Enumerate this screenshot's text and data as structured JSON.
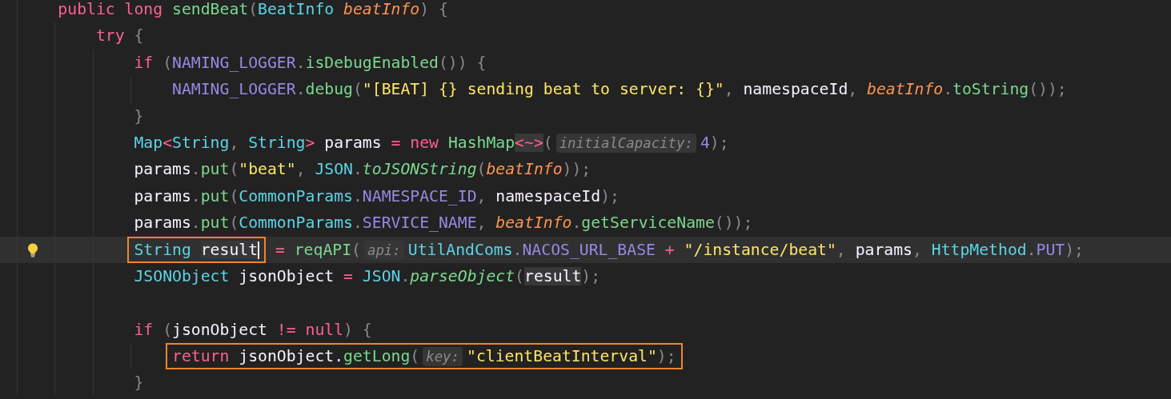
{
  "lines": [
    {
      "current": false,
      "tokens": [
        {
          "kind": "keyword",
          "text": "public "
        },
        {
          "kind": "keyword",
          "text": "long "
        },
        {
          "kind": "function",
          "text": "sendBeat"
        },
        {
          "kind": "punct",
          "text": "("
        },
        {
          "kind": "type",
          "text": "BeatInfo "
        },
        {
          "kind": "param",
          "text": "beatInfo"
        },
        {
          "kind": "punct",
          "text": ") {"
        }
      ],
      "children": [
        {
          "current": false,
          "tokens": [
            {
              "kind": "keyword",
              "text": "try "
            },
            {
              "kind": "punct",
              "text": "{"
            }
          ],
          "children": [
            {
              "current": false,
              "tokens": [
                {
                  "kind": "keyword",
                  "text": "if "
                },
                {
                  "kind": "punct",
                  "text": "("
                },
                {
                  "kind": "constant",
                  "text": "NAMING_LOGGER"
                },
                {
                  "kind": "punct",
                  "text": "."
                },
                {
                  "kind": "function",
                  "text": "isDebugEnabled"
                },
                {
                  "kind": "punct",
                  "text": "()) {"
                }
              ],
              "children": [
                {
                  "current": false,
                  "tokens": [
                    {
                      "kind": "constant",
                      "text": "NAMING_LOGGER"
                    },
                    {
                      "kind": "punct",
                      "text": "."
                    },
                    {
                      "kind": "function",
                      "text": "debug"
                    },
                    {
                      "kind": "punct",
                      "text": "("
                    },
                    {
                      "kind": "string",
                      "text": "\"[BEAT] {} sending beat to server: {}\""
                    },
                    {
                      "kind": "punct",
                      "text": ", "
                    },
                    {
                      "kind": "plain",
                      "text": "namespaceId"
                    },
                    {
                      "kind": "punct",
                      "text": ", "
                    },
                    {
                      "kind": "param",
                      "text": "beatInfo"
                    },
                    {
                      "kind": "punct",
                      "text": "."
                    },
                    {
                      "kind": "function",
                      "text": "toString"
                    },
                    {
                      "kind": "punct",
                      "text": "());"
                    }
                  ]
                }
              ]
            },
            {
              "current": false,
              "tokens": [
                {
                  "kind": "punct",
                  "text": "}"
                }
              ]
            },
            {
              "current": false,
              "tokens": [
                {
                  "kind": "type",
                  "text": "Map"
                },
                {
                  "kind": "operator",
                  "text": "<"
                },
                {
                  "kind": "type",
                  "text": "String"
                },
                {
                  "kind": "punct",
                  "text": ", "
                },
                {
                  "kind": "type",
                  "text": "String"
                },
                {
                  "kind": "operator",
                  "text": "> "
                },
                {
                  "kind": "plain",
                  "text": "params "
                },
                {
                  "kind": "operator",
                  "text": "= "
                },
                {
                  "kind": "keyword",
                  "text": "new "
                },
                {
                  "kind": "function",
                  "text": "HashMap"
                },
                {
                  "kind": "operator",
                  "text": "<~>",
                  "shaded": true
                },
                {
                  "kind": "punct",
                  "text": "("
                },
                {
                  "kind": "hint",
                  "text": "initialCapacity:"
                },
                {
                  "kind": "number",
                  "text": "4"
                },
                {
                  "kind": "punct",
                  "text": ");"
                }
              ]
            },
            {
              "current": false,
              "tokens": [
                {
                  "kind": "plain",
                  "text": "params"
                },
                {
                  "kind": "punct",
                  "text": "."
                },
                {
                  "kind": "function",
                  "text": "put"
                },
                {
                  "kind": "punct",
                  "text": "("
                },
                {
                  "kind": "string",
                  "text": "\"beat\""
                },
                {
                  "kind": "punct",
                  "text": ", "
                },
                {
                  "kind": "type",
                  "text": "JSON"
                },
                {
                  "kind": "punct",
                  "text": "."
                },
                {
                  "kind": "static",
                  "text": "toJSONString"
                },
                {
                  "kind": "punct",
                  "text": "("
                },
                {
                  "kind": "param",
                  "text": "beatInfo"
                },
                {
                  "kind": "punct",
                  "text": "));"
                }
              ]
            },
            {
              "current": false,
              "tokens": [
                {
                  "kind": "plain",
                  "text": "params"
                },
                {
                  "kind": "punct",
                  "text": "."
                },
                {
                  "kind": "function",
                  "text": "put"
                },
                {
                  "kind": "punct",
                  "text": "("
                },
                {
                  "kind": "type",
                  "text": "CommonParams"
                },
                {
                  "kind": "punct",
                  "text": "."
                },
                {
                  "kind": "constant",
                  "text": "NAMESPACE_ID"
                },
                {
                  "kind": "punct",
                  "text": ", "
                },
                {
                  "kind": "plain",
                  "text": "namespaceId"
                },
                {
                  "kind": "punct",
                  "text": ");"
                }
              ]
            },
            {
              "current": false,
              "tokens": [
                {
                  "kind": "plain",
                  "text": "params"
                },
                {
                  "kind": "punct",
                  "text": "."
                },
                {
                  "kind": "function",
                  "text": "put"
                },
                {
                  "kind": "punct",
                  "text": "("
                },
                {
                  "kind": "type",
                  "text": "CommonParams"
                },
                {
                  "kind": "punct",
                  "text": "."
                },
                {
                  "kind": "constant",
                  "text": "SERVICE_NAME"
                },
                {
                  "kind": "punct",
                  "text": ", "
                },
                {
                  "kind": "param",
                  "text": "beatInfo"
                },
                {
                  "kind": "punct",
                  "text": "."
                },
                {
                  "kind": "function",
                  "text": "getServiceName"
                },
                {
                  "kind": "punct",
                  "text": "());"
                }
              ]
            },
            {
              "current": true,
              "lightbulb": true,
              "tokens": [
                {
                  "kind": "frame",
                  "tokens": [
                    {
                      "kind": "type",
                      "text": "String "
                    },
                    {
                      "kind": "plain",
                      "text": "result",
                      "shaded": true
                    },
                    {
                      "kind": "caret"
                    }
                  ]
                },
                {
                  "kind": "operator",
                  "text": " = "
                },
                {
                  "kind": "function",
                  "text": "reqAPI"
                },
                {
                  "kind": "punct",
                  "text": "("
                },
                {
                  "kind": "hint",
                  "text": "api:"
                },
                {
                  "kind": "type",
                  "text": "UtilAndComs"
                },
                {
                  "kind": "punct",
                  "text": "."
                },
                {
                  "kind": "constant",
                  "text": "NACOS_URL_BASE "
                },
                {
                  "kind": "operator",
                  "text": "+ "
                },
                {
                  "kind": "string",
                  "text": "\"/instance/beat\""
                },
                {
                  "kind": "punct",
                  "text": ", "
                },
                {
                  "kind": "plain",
                  "text": "params"
                },
                {
                  "kind": "punct",
                  "text": ", "
                },
                {
                  "kind": "type",
                  "text": "HttpMethod"
                },
                {
                  "kind": "punct",
                  "text": "."
                },
                {
                  "kind": "constant",
                  "text": "PUT"
                },
                {
                  "kind": "punct",
                  "text": ");"
                }
              ]
            },
            {
              "current": false,
              "tokens": [
                {
                  "kind": "type",
                  "text": "JSONObject "
                },
                {
                  "kind": "plain",
                  "text": "jsonObject "
                },
                {
                  "kind": "operator",
                  "text": "= "
                },
                {
                  "kind": "type",
                  "text": "JSON"
                },
                {
                  "kind": "punct",
                  "text": "."
                },
                {
                  "kind": "static",
                  "text": "parseObject"
                },
                {
                  "kind": "punct",
                  "text": "("
                },
                {
                  "kind": "plain",
                  "text": "result",
                  "shaded": true
                },
                {
                  "kind": "punct",
                  "text": ");"
                }
              ]
            },
            {
              "current": false
            },
            {
              "current": false,
              "tokens": [
                {
                  "kind": "keyword",
                  "text": "if "
                },
                {
                  "kind": "punct",
                  "text": "("
                },
                {
                  "kind": "plain",
                  "text": "jsonObject "
                },
                {
                  "kind": "operator",
                  "text": "!= "
                },
                {
                  "kind": "keyword",
                  "text": "null"
                },
                {
                  "kind": "punct",
                  "text": ") {"
                }
              ],
              "children": [
                {
                  "current": false,
                  "tokens": [
                    {
                      "kind": "frame",
                      "tokens": [
                        {
                          "kind": "keyword",
                          "text": "return "
                        },
                        {
                          "kind": "plain",
                          "text": "jsonObject."
                        },
                        {
                          "kind": "function",
                          "text": "getLong"
                        },
                        {
                          "kind": "punct",
                          "text": "("
                        },
                        {
                          "kind": "hint",
                          "text": "key:"
                        },
                        {
                          "kind": "string",
                          "text": "\"clientBeatInterval\""
                        },
                        {
                          "kind": "punct",
                          "text": ");"
                        }
                      ]
                    }
                  ]
                }
              ]
            },
            {
              "current": false,
              "tokens": [
                {
                  "kind": "punct",
                  "text": "}"
                }
              ]
            }
          ]
        }
      ]
    }
  ]
}
